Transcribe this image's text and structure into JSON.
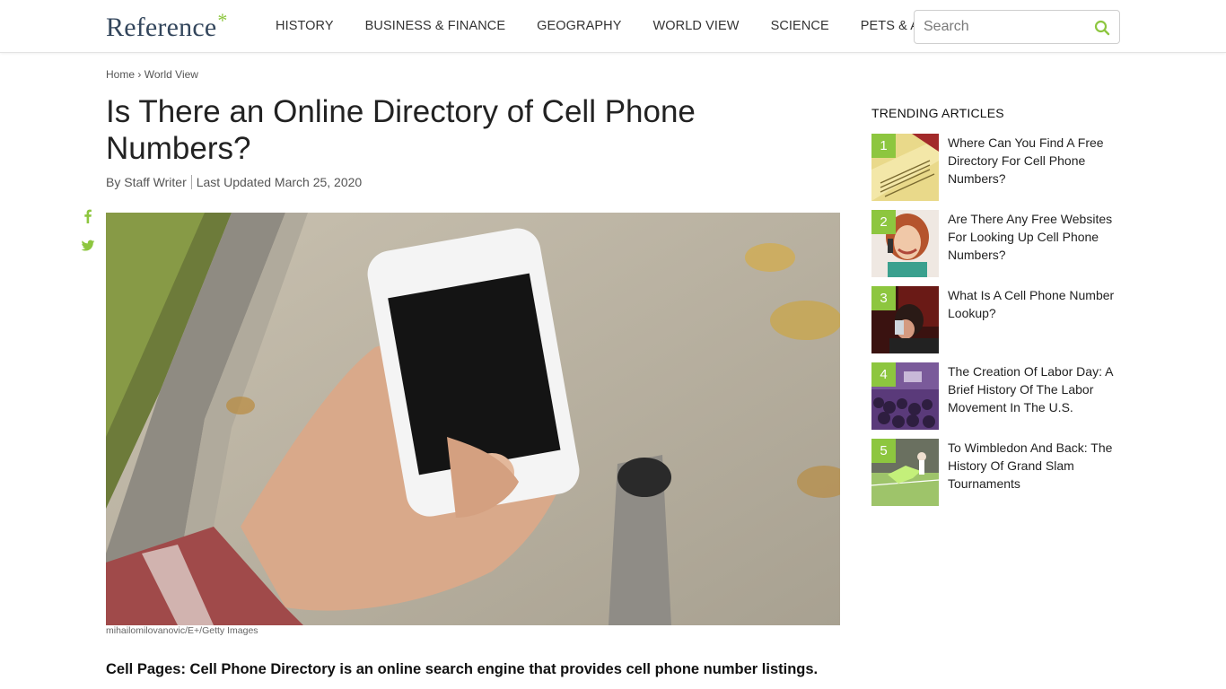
{
  "header": {
    "logo": "Reference",
    "logo_mark": "*",
    "nav": [
      "HISTORY",
      "BUSINESS & FINANCE",
      "GEOGRAPHY",
      "WORLD VIEW",
      "SCIENCE",
      "PETS & ANIMALS"
    ],
    "search_placeholder": "Search",
    "search_icon": "search-icon"
  },
  "breadcrumb": {
    "home": "Home",
    "separator": "›",
    "section": "World View"
  },
  "article": {
    "title": "Is There an Online Directory of Cell Phone Numbers?",
    "author": "By Staff Writer",
    "updated": "Last Updated March 25, 2020",
    "image_credit": "mihailomilovanovic/E+/Getty Images",
    "lede": "Cell Pages: Cell Phone Directory is an online search engine that provides cell phone number listings."
  },
  "social": {
    "facebook_icon": "facebook-icon",
    "twitter_icon": "twitter-icon"
  },
  "trending": {
    "heading": "TRENDING ARTICLES",
    "items": [
      {
        "num": "1",
        "title": "Where Can You Find A Free Directory For Cell Phone Numbers?"
      },
      {
        "num": "2",
        "title": "Are There Any Free Websites For Looking Up Cell Phone Numbers?"
      },
      {
        "num": "3",
        "title": "What Is A Cell Phone Number Lookup?"
      },
      {
        "num": "4",
        "title": "The Creation Of Labor Day: A Brief History Of The Labor Movement In The U.S."
      },
      {
        "num": "5",
        "title": "To Wimbledon And Back: The History Of Grand Slam Tournaments"
      }
    ]
  },
  "colors": {
    "accent": "#8dc63f",
    "logo": "#33465c"
  }
}
